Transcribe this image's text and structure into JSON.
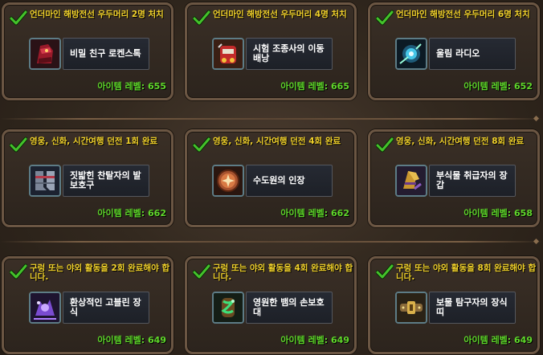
{
  "cards": [
    {
      "title": "언더마인 해방전선 우두머리 2명 처치",
      "item": "비밀 친구 로켄스톡",
      "level_label": "아이템 레벨: 655",
      "icon": "crimson-gauntlet-icon"
    },
    {
      "title": "언더마인 해방전선 우두머리 4명 처치",
      "item": "시험 조종사의 이동 배낭",
      "level_label": "아이템 레벨: 665",
      "icon": "rocket-pack-icon"
    },
    {
      "title": "언더마인 해방전선 우두머리 6명 처치",
      "item": "울림 라디오",
      "level_label": "아이템 레벨: 652",
      "icon": "radio-device-icon"
    },
    {
      "title": "영웅, 신화, 시간여행 던전 1회 완료",
      "item": "짓밟힌 찬탈자의 발보호구",
      "level_label": "아이템 레벨: 662",
      "icon": "armored-boots-icon"
    },
    {
      "title": "영웅, 신화, 시간여행 던전 4회 완료",
      "item": "수도원의 인장",
      "level_label": "아이템 레벨: 662",
      "icon": "abbey-seal-icon"
    },
    {
      "title": "영웅, 신화, 시간여행 던전 8회 완료",
      "item": "부식물 취급자의 장갑",
      "level_label": "아이템 레벨: 658",
      "icon": "corroded-gloves-icon"
    },
    {
      "title": "구렁 또는 야외 활동을 2회 완료해야 합니다.",
      "item": "환상적인 고블린 장식",
      "level_label": "아이템 레벨: 649",
      "icon": "goblin-trinket-icon"
    },
    {
      "title": "구렁 또는 야외 활동을 4회 완료해야 합니다.",
      "item": "영원한 뱀의 손보호대",
      "level_label": "아이템 레벨: 649",
      "icon": "serpent-bracer-icon"
    },
    {
      "title": "구렁 또는 야외 활동을 8회 완료해야 합니다.",
      "item": "보물 탐구자의 장식띠",
      "level_label": "아이템 레벨: 649",
      "icon": "treasure-belt-icon"
    }
  ],
  "colors": {
    "title": "#f2d22a",
    "level": "#5fd82a",
    "check": "#3fbf2a",
    "border": "#6b5643"
  }
}
